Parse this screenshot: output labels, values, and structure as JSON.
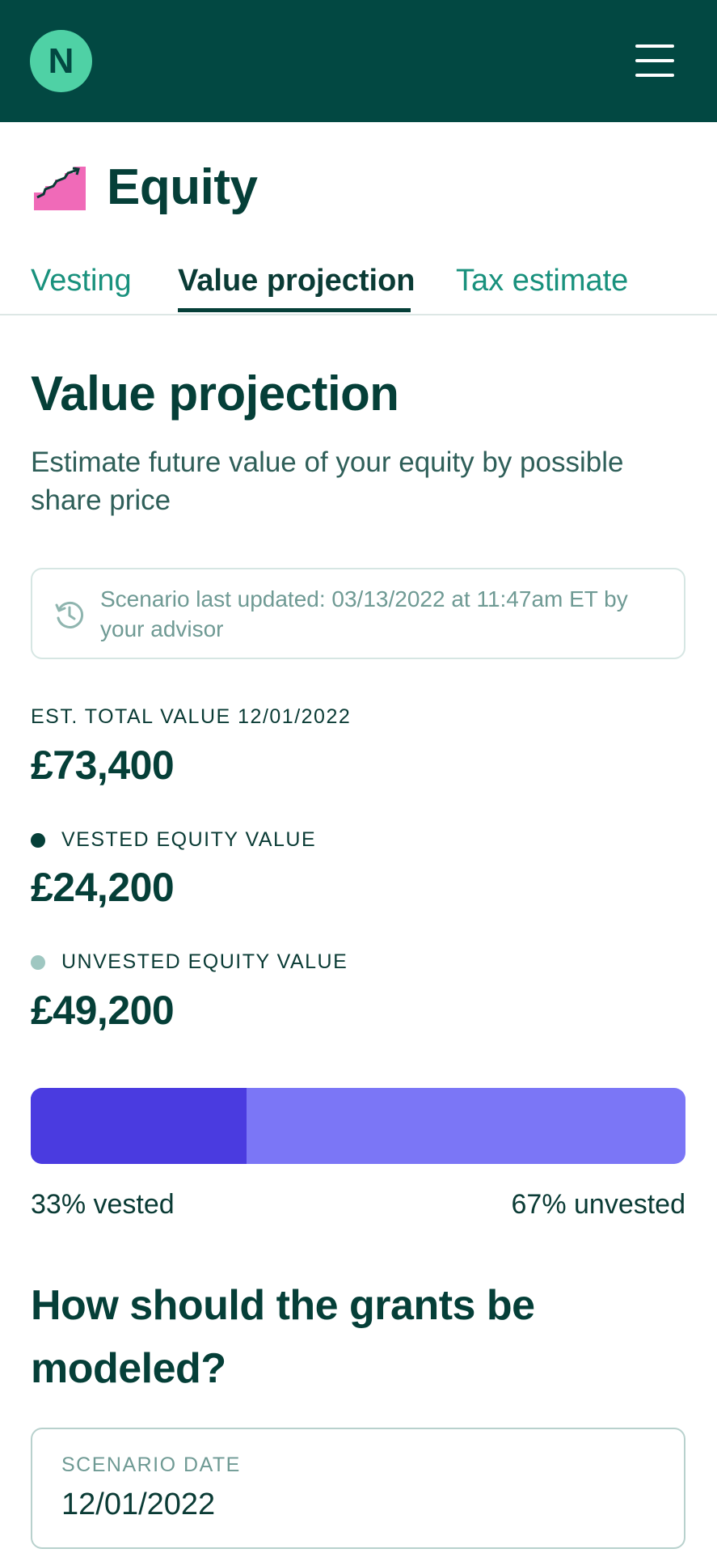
{
  "topbar": {
    "logo_letter": "N",
    "menu_icon": "hamburger-menu-icon"
  },
  "header": {
    "icon": "growth-stairs-icon",
    "title": "Equity"
  },
  "tabs": [
    {
      "label": "Vesting"
    },
    {
      "label": "Value projection",
      "active": true
    },
    {
      "label": "Tax estimate"
    }
  ],
  "section": {
    "title": "Value projection",
    "subtitle": "Estimate future value of your equity by possible share price"
  },
  "notice": {
    "icon": "history-clock-icon",
    "text": "Scenario last updated: 03/13/2022 at 11:47am ET by your advisor"
  },
  "totals": {
    "total_label": "EST. TOTAL VALUE 12/01/2022",
    "total_value": "£73,400",
    "vested_label": "VESTED EQUITY VALUE",
    "vested_value": "£24,200",
    "unvested_label": "UNVESTED EQUITY VALUE",
    "unvested_value": "£49,200"
  },
  "progress": {
    "vested_fraction": 0.33,
    "vested_text": "33% vested",
    "unvested_text": "67% unvested"
  },
  "modeling": {
    "question": "How should the grants be modeled?",
    "field_label": "SCENARIO DATE",
    "field_value": "12/01/2022"
  },
  "colors": {
    "topbar": "#024842",
    "logo": "#4fd1a5",
    "vested_dot": "#053f38",
    "unvested_dot": "#9fc7c1",
    "progress_vested": "#4a3be0",
    "progress_unvested": "#7b76f6"
  }
}
